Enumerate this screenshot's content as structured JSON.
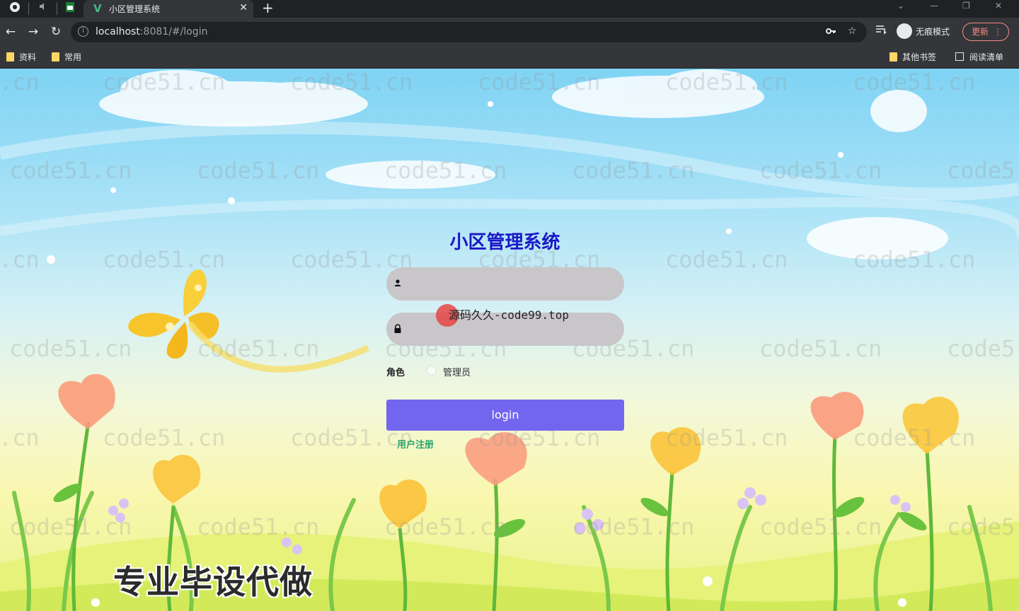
{
  "browser": {
    "tab_title": "小区管理系统",
    "tab_close": "✕",
    "new_tab": "+",
    "url_host": "localhost",
    "url_rest": ":8081/#/login",
    "incognito_label": "无痕模式",
    "update_label": "更新",
    "update_menu": "⋮",
    "bookmarks": [
      "资料",
      "常用"
    ],
    "other_bookmarks": "其他书签",
    "reading_list": "阅读清单",
    "icons": [
      "chrome-icon",
      "speaker-icon",
      "sheets-icon",
      "vue-icon",
      "back-icon",
      "forward-icon",
      "reload-icon",
      "info-icon",
      "key-icon",
      "star-icon",
      "tab-search-icon",
      "incognito-icon",
      "minimize-icon",
      "restore-icon",
      "close-window-icon"
    ]
  },
  "login": {
    "title": "小区管理系统",
    "username_placeholder": "",
    "password_placeholder": "",
    "role_label": "角色",
    "role_option": "管理员",
    "login_button": "login",
    "register_link": "用户注册"
  },
  "overlays": {
    "watermark": "code51.cn",
    "watermark_partial_start": ".cn",
    "watermark_partial_end": "code5",
    "source_caption": "源码久久-code99.top",
    "promo_text": "专业毕设代做"
  },
  "colors": {
    "title": "#1a17c7",
    "field_bg": "#c8c6c9",
    "login_button": "#7266ef",
    "register_link": "#2aa46f",
    "browser_bg": "#202124",
    "toolbar_bg": "#35363a"
  }
}
